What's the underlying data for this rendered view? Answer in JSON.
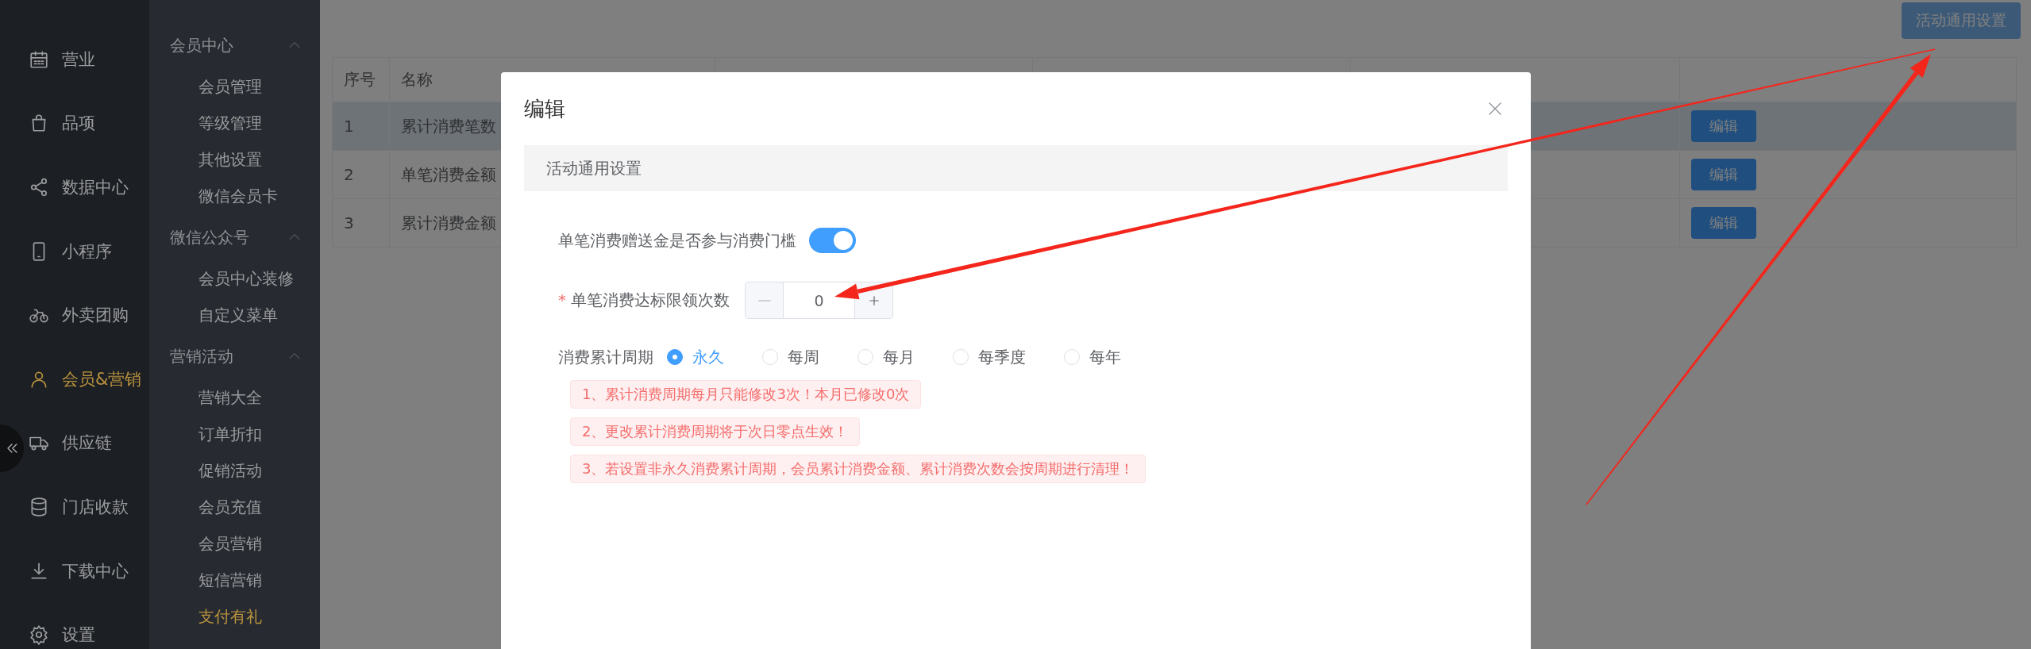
{
  "nav": [
    {
      "label": "营业",
      "selected": false
    },
    {
      "label": "品项",
      "selected": false
    },
    {
      "label": "数据中心",
      "selected": false
    },
    {
      "label": "小程序",
      "selected": false
    },
    {
      "label": "外卖团购",
      "selected": false
    },
    {
      "label": "会员&营销",
      "selected": true
    },
    {
      "label": "供应链",
      "selected": false
    },
    {
      "label": "门店收款",
      "selected": false
    },
    {
      "label": "下载中心",
      "selected": false
    },
    {
      "label": "设置",
      "selected": false
    }
  ],
  "submenu": [
    {
      "label": "会员中心",
      "expanded": true,
      "children": [
        {
          "label": "会员管理",
          "selected": false
        },
        {
          "label": "等级管理",
          "selected": false
        },
        {
          "label": "其他设置",
          "selected": false
        },
        {
          "label": "微信会员卡",
          "selected": false
        }
      ]
    },
    {
      "label": "微信公众号",
      "expanded": true,
      "children": [
        {
          "label": "会员中心装修",
          "selected": false
        },
        {
          "label": "自定义菜单",
          "selected": false
        }
      ]
    },
    {
      "label": "营销活动",
      "expanded": true,
      "children": [
        {
          "label": "营销大全",
          "selected": false
        },
        {
          "label": "订单折扣",
          "selected": false
        },
        {
          "label": "促销活动",
          "selected": false
        },
        {
          "label": "会员充值",
          "selected": false
        },
        {
          "label": "会员营销",
          "selected": false
        },
        {
          "label": "短信营销",
          "selected": false
        },
        {
          "label": "支付有礼",
          "selected": true
        }
      ]
    }
  ],
  "toolbar": {
    "button": "活动通用设置"
  },
  "table": {
    "columns": [
      "序号",
      "名称"
    ],
    "rows": [
      {
        "cells": [
          "1",
          "累计消费笔数"
        ],
        "highlighted": true,
        "action": "编辑"
      },
      {
        "cells": [
          "2",
          "单笔消费金额"
        ],
        "highlighted": false,
        "action": "编辑"
      },
      {
        "cells": [
          "3",
          "累计消费金额"
        ],
        "highlighted": false,
        "action": "编辑"
      }
    ]
  },
  "dialog": {
    "title": "编辑",
    "section": "活动通用设置",
    "fields": [
      {
        "kind": "switch",
        "label": "单笔消费赠送金是否参与消费门槛",
        "on": true
      },
      {
        "kind": "number",
        "label": "单笔消费达标限领次数",
        "required_mark": "*",
        "value": "0",
        "minus_disabled": true
      },
      {
        "kind": "radio",
        "label": "消费累计周期",
        "options": [
          {
            "label": "永久",
            "selected": true
          },
          {
            "label": "每周",
            "selected": false
          },
          {
            "label": "每月",
            "selected": false
          },
          {
            "label": "每季度",
            "selected": false
          },
          {
            "label": "每年",
            "selected": false
          }
        ]
      }
    ],
    "notes": [
      "1、累计消费周期每月只能修改3次！本月已修改0次",
      "2、更改累计消费周期将于次日零点生效！",
      "3、若设置非永久消费累计周期，会员累计消费金额、累计消费次数会按周期进行清理！"
    ]
  }
}
